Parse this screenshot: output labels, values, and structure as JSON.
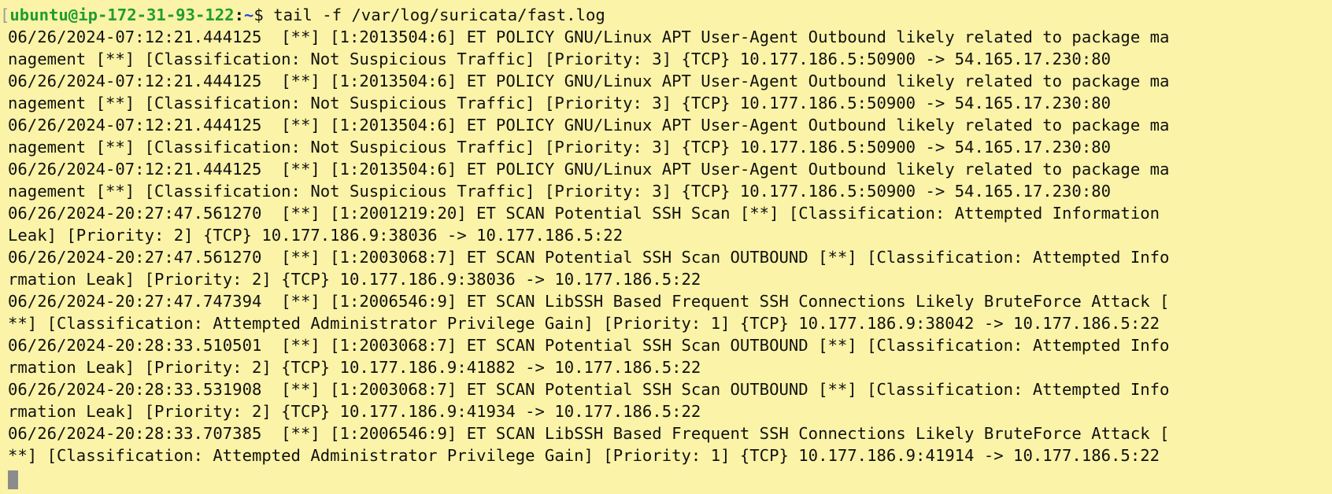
{
  "prompt": {
    "bracket_open": "[",
    "user_host": "ubuntu@ip-172-31-93-122",
    "colon": ":",
    "path": "~",
    "symbol": "$ ",
    "command": "tail -f /var/log/suricata/fast.log"
  },
  "output_lines": [
    "06/26/2024-07:12:21.444125  [**] [1:2013504:6] ET POLICY GNU/Linux APT User-Agent Outbound likely related to package ma",
    "nagement [**] [Classification: Not Suspicious Traffic] [Priority: 3] {TCP} 10.177.186.5:50900 -> 54.165.17.230:80",
    "06/26/2024-07:12:21.444125  [**] [1:2013504:6] ET POLICY GNU/Linux APT User-Agent Outbound likely related to package ma",
    "nagement [**] [Classification: Not Suspicious Traffic] [Priority: 3] {TCP} 10.177.186.5:50900 -> 54.165.17.230:80",
    "06/26/2024-07:12:21.444125  [**] [1:2013504:6] ET POLICY GNU/Linux APT User-Agent Outbound likely related to package ma",
    "nagement [**] [Classification: Not Suspicious Traffic] [Priority: 3] {TCP} 10.177.186.5:50900 -> 54.165.17.230:80",
    "06/26/2024-07:12:21.444125  [**] [1:2013504:6] ET POLICY GNU/Linux APT User-Agent Outbound likely related to package ma",
    "nagement [**] [Classification: Not Suspicious Traffic] [Priority: 3] {TCP} 10.177.186.5:50900 -> 54.165.17.230:80",
    "06/26/2024-20:27:47.561270  [**] [1:2001219:20] ET SCAN Potential SSH Scan [**] [Classification: Attempted Information",
    "Leak] [Priority: 2] {TCP} 10.177.186.9:38036 -> 10.177.186.5:22",
    "06/26/2024-20:27:47.561270  [**] [1:2003068:7] ET SCAN Potential SSH Scan OUTBOUND [**] [Classification: Attempted Info",
    "rmation Leak] [Priority: 2] {TCP} 10.177.186.9:38036 -> 10.177.186.5:22",
    "06/26/2024-20:27:47.747394  [**] [1:2006546:9] ET SCAN LibSSH Based Frequent SSH Connections Likely BruteForce Attack [",
    "**] [Classification: Attempted Administrator Privilege Gain] [Priority: 1] {TCP} 10.177.186.9:38042 -> 10.177.186.5:22",
    "06/26/2024-20:28:33.510501  [**] [1:2003068:7] ET SCAN Potential SSH Scan OUTBOUND [**] [Classification: Attempted Info",
    "rmation Leak] [Priority: 2] {TCP} 10.177.186.9:41882 -> 10.177.186.5:22",
    "06/26/2024-20:28:33.531908  [**] [1:2003068:7] ET SCAN Potential SSH Scan OUTBOUND [**] [Classification: Attempted Info",
    "rmation Leak] [Priority: 2] {TCP} 10.177.186.9:41934 -> 10.177.186.5:22",
    "06/26/2024-20:28:33.707385  [**] [1:2006546:9] ET SCAN LibSSH Based Frequent SSH Connections Likely BruteForce Attack [",
    "**] [Classification: Attempted Administrator Privilege Gain] [Priority: 1] {TCP} 10.177.186.9:41914 -> 10.177.186.5:22"
  ],
  "colors": {
    "background": "#FBF3A7",
    "user_host": "#1f9e2f",
    "path": "#2346d3",
    "text": "#111111",
    "cursor": "#8c8c8c"
  }
}
